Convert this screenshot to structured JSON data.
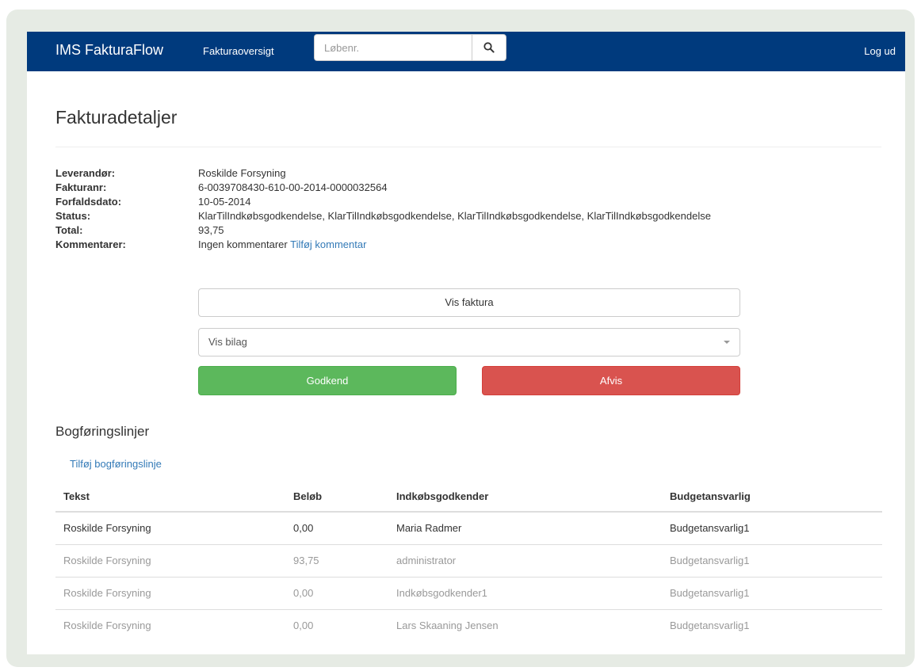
{
  "navbar": {
    "brand": "IMS FakturaFlow",
    "nav_link": "Fakturaoversigt",
    "search_placeholder": "Løbenr.",
    "logout": "Log ud"
  },
  "page": {
    "title": "Fakturadetaljer"
  },
  "details": {
    "supplier_label": "Leverandør:",
    "supplier": "Roskilde Forsyning",
    "invoice_no_label": "Fakturanr:",
    "invoice_no": "6-0039708430-610-00-2014-0000032564",
    "due_date_label": "Forfaldsdato:",
    "due_date": "10-05-2014",
    "status_label": "Status:",
    "status": "KlarTilIndkøbsgodkendelse, KlarTilIndkøbsgodkendelse, KlarTilIndkøbsgodkendelse, KlarTilIndkøbsgodkendelse",
    "total_label": "Total:",
    "total": "93,75",
    "comments_label": "Kommentarer:",
    "comments": "Ingen kommentarer",
    "add_comment": "Tilføj kommentar"
  },
  "actions": {
    "view_invoice": "Vis faktura",
    "attachments_placeholder": "Vis bilag",
    "approve": "Godkend",
    "reject": "Afvis"
  },
  "posting_lines": {
    "title": "Bogføringslinjer",
    "add_line": "Tilføj bogføringslinje",
    "headers": [
      "Tekst",
      "Beløb",
      "Indkøbsgodkender",
      "Budgetansvarlig"
    ],
    "rows": [
      [
        "Roskilde Forsyning",
        "0,00",
        "Maria Radmer",
        "Budgetansvarlig1"
      ],
      [
        "Roskilde Forsyning",
        "93,75",
        "administrator",
        "Budgetansvarlig1"
      ],
      [
        "Roskilde Forsyning",
        "0,00",
        "Indkøbsgodkender1",
        "Budgetansvarlig1"
      ],
      [
        "Roskilde Forsyning",
        "0,00",
        "Lars Skaaning Jensen",
        "Budgetansvarlig1"
      ]
    ]
  },
  "colors": {
    "navbar": "#003a7d",
    "approve": "#5cb85c",
    "reject": "#d9534f",
    "link": "#337ab7"
  }
}
